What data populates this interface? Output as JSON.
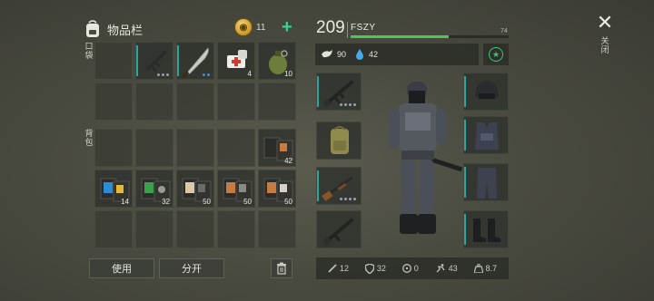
{
  "inventory": {
    "title": "物品栏",
    "coins": "11",
    "pockets_label": "口袋",
    "backpack_label": "背包",
    "pocket_counts": {
      "medkit": "4",
      "grenade": "10"
    },
    "backpack_counts": {
      "r1c5": "42",
      "r2c1": "14",
      "r2c2": "32",
      "r2c3": "50",
      "r2c4": "50",
      "r2c5": "50"
    }
  },
  "actions": {
    "use_label": "使用",
    "split_label": "分开"
  },
  "character": {
    "level": "209",
    "name": "FSZY",
    "xp_max": "74",
    "xp_fraction": 0.62,
    "food": "90",
    "water": "42"
  },
  "stats": {
    "attack": "12",
    "defense": "32",
    "radiation": "0",
    "speed": "43",
    "weight": "8.7"
  },
  "close_label": "关闭",
  "colors": {
    "accent_green": "#39d39a",
    "xp_green": "#4cc84e",
    "teal_bar": "#2aa6a0",
    "rarity_blue": "#3c8ee6"
  },
  "icons": [
    "backpack-icon",
    "coin-icon",
    "plus-icon",
    "rifle-icon",
    "machete-icon",
    "medkit-icon",
    "grenade-icon",
    "recipe-book-icon",
    "trash-icon",
    "food-icon",
    "water-icon",
    "star-icon",
    "helmet-icon",
    "vest-icon",
    "pants-icon",
    "boots-icon",
    "shotgun-icon",
    "close-icon"
  ]
}
